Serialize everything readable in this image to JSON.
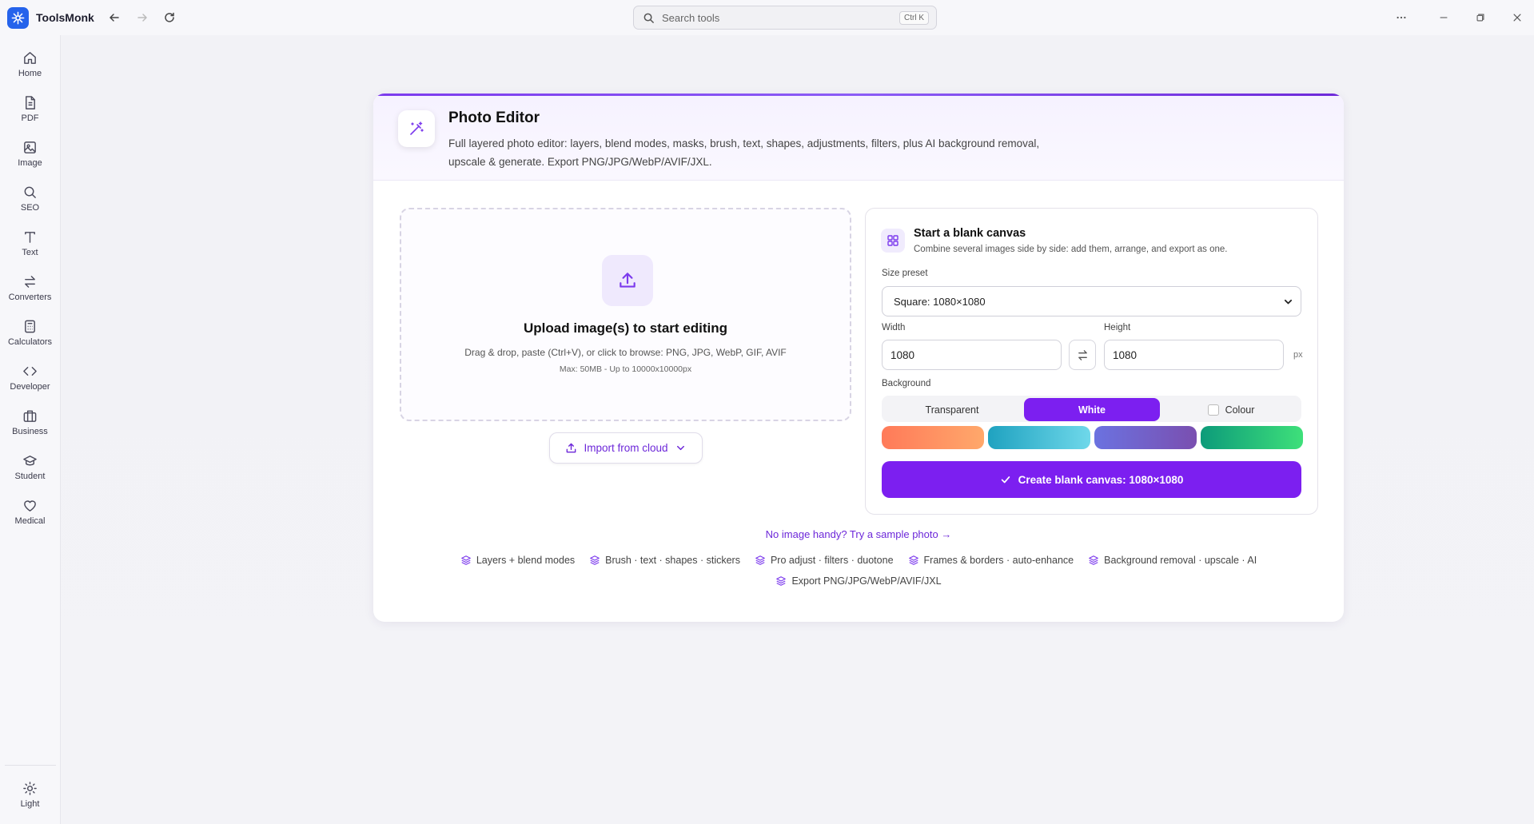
{
  "app": {
    "title": "ToolsMonk"
  },
  "search": {
    "placeholder": "Search tools",
    "shortcut": "Ctrl K"
  },
  "sidebar": {
    "items": [
      {
        "label": "Home",
        "icon": "home-icon"
      },
      {
        "label": "PDF",
        "icon": "file-icon"
      },
      {
        "label": "Image",
        "icon": "image-icon"
      },
      {
        "label": "SEO",
        "icon": "search-icon"
      },
      {
        "label": "Text",
        "icon": "text-icon"
      },
      {
        "label": "Converters",
        "icon": "arrows-swap-icon"
      },
      {
        "label": "Calculators",
        "icon": "calculator-icon"
      },
      {
        "label": "Developer",
        "icon": "code-icon"
      },
      {
        "label": "Business",
        "icon": "briefcase-icon"
      },
      {
        "label": "Student",
        "icon": "graduation-cap-icon"
      },
      {
        "label": "Medical",
        "icon": "heart-icon"
      }
    ],
    "theme_label": "Light"
  },
  "header": {
    "title": "Photo Editor",
    "description": "Full layered photo editor: layers, blend modes, masks, brush, text, shapes, adjustments, filters, plus AI background removal, upscale & generate. Export PNG/JPG/WebP/AVIF/JXL."
  },
  "upload": {
    "title": "Upload image(s) to start editing",
    "subtitle": "Drag & drop, paste (Ctrl+V), or click to browse: PNG, JPG, WebP, GIF, AVIF",
    "max": "Max: 50MB - Up to 10000x10000px",
    "cloud_button": "Import from cloud"
  },
  "canvas": {
    "title": "Start a blank canvas",
    "description": "Combine several images side by side: add them, arrange, and export as one.",
    "size_preset_label": "Size preset",
    "size_preset_value": "Square: 1080×1080",
    "width_label": "Width",
    "width_value": "1080",
    "height_label": "Height",
    "height_value": "1080",
    "unit": "px",
    "background_label": "Background",
    "background_options": [
      "Transparent",
      "White",
      "Colour"
    ],
    "background_selected": "White",
    "gradients": [
      {
        "name": "orange",
        "from": "#ff7a59",
        "to": "#ffa86b"
      },
      {
        "name": "teal",
        "from": "#1fa2c0",
        "to": "#6fd8ea"
      },
      {
        "name": "purple",
        "from": "#6b72e0",
        "to": "#7a4fb0"
      },
      {
        "name": "green",
        "from": "#0d9b7a",
        "to": "#3ee07a"
      }
    ],
    "create_button": "Create blank canvas: 1080×1080"
  },
  "footer": {
    "sample_link": "No image handy? Try a sample photo →",
    "features": [
      "Layers + blend modes",
      "Brush · text · shapes · stickers",
      "Pro adjust · filters · duotone",
      "Frames & borders · auto-enhance",
      "Background removal · upscale · AI",
      "Export PNG/JPG/WebP/AVIF/JXL"
    ]
  },
  "colors": {
    "accent": "#7c1ff0",
    "link": "#6d28d9"
  }
}
